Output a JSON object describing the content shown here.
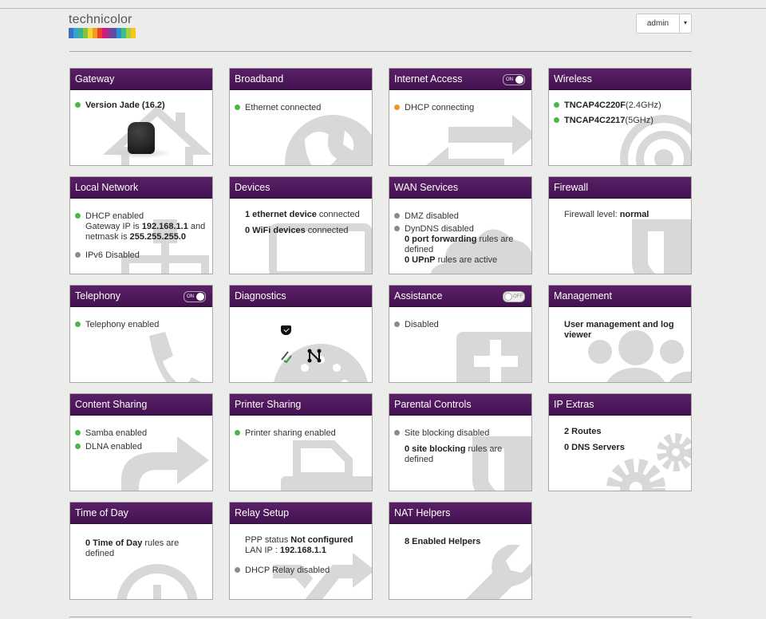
{
  "header": {
    "logo_text": "technicolor",
    "logo_colors": [
      "#3d6fc4",
      "#37a0d8",
      "#35b58f",
      "#82c341",
      "#f4d62b",
      "#f39a21",
      "#e8412c",
      "#d4187a",
      "#8b3a9b",
      "#5a4fa3",
      "#2c8fd1",
      "#3bbf8a",
      "#a6cf39",
      "#f6c51e"
    ],
    "user_menu": "admin",
    "user_caret": "▾"
  },
  "theme": {
    "header_purple": "#4a1656",
    "ok": "#4cb54c",
    "warn": "#e89a24",
    "off": "#8c8c8c"
  },
  "cards": {
    "gateway": {
      "title": "Gateway",
      "version": "Version Jade (16.2)",
      "icon": "house-icon"
    },
    "broadband": {
      "title": "Broadband",
      "status": "Ethernet connected",
      "icon": "globe-icon"
    },
    "internet": {
      "title": "Internet Access",
      "toggle": "ON",
      "status": "DHCP connecting",
      "icon": "arrows-icon"
    },
    "wireless": {
      "title": "Wireless",
      "ssid1": "TNCAP4C220F",
      "band1": "(2.4GHz)",
      "ssid2": "TNCAP4C2217",
      "band2": "(5GHz)",
      "icon": "wifi-target-icon"
    },
    "local": {
      "title": "Local Network",
      "dhcp": "DHCP enabled",
      "gw_pre": "Gateway IP is ",
      "gw_ip": "192.168.1.1",
      "gw_mid": " and netmask is ",
      "netmask": "255.255.255.0",
      "ipv6": "IPv6 Disabled",
      "icon": "network-icon"
    },
    "devices": {
      "title": "Devices",
      "eth_count": "1 ethernet device",
      "eth_suffix": " connected",
      "wifi_count": "0 WiFi devices",
      "wifi_suffix": " connected",
      "icon": "monitor-icon"
    },
    "wan": {
      "title": "WAN Services",
      "dmz": "DMZ disabled",
      "dyndns": "DynDNS disabled",
      "pf_count": "0 port forwarding",
      "pf_suffix": " rules are defined",
      "upnp_count": "0 UPnP",
      "upnp_suffix": " rules are active",
      "icon": "cloud-icon"
    },
    "firewall": {
      "title": "Firewall",
      "label": "Firewall level: ",
      "level": "normal",
      "icon": "shield-icon"
    },
    "telephony": {
      "title": "Telephony",
      "toggle": "ON",
      "status": "Telephony enabled",
      "icon": "phone-icon"
    },
    "diagnostics": {
      "title": "Diagnostics",
      "icon": "dial-icon"
    },
    "assistance": {
      "title": "Assistance",
      "toggle": "OFF",
      "status": "Disabled",
      "icon": "medkit-icon"
    },
    "management": {
      "title": "Management",
      "text": "User management and log viewer",
      "icon": "users-icon"
    },
    "content": {
      "title": "Content Sharing",
      "samba": "Samba enabled",
      "dlna": "DLNA enabled",
      "icon": "share-icon"
    },
    "printer": {
      "title": "Printer Sharing",
      "status": "Printer sharing enabled",
      "icon": "printer-icon"
    },
    "parental": {
      "title": "Parental Controls",
      "blocking": "Site blocking disabled",
      "rules_count": "0 site blocking",
      "rules_suffix": " rules are defined",
      "icon": "shield-icon"
    },
    "ipextras": {
      "title": "IP Extras",
      "routes": "2 Routes",
      "dns": "0 DNS Servers",
      "icon": "gears-icon"
    },
    "tod": {
      "title": "Time of Day",
      "count": "0 Time of Day",
      "suffix": " rules are defined",
      "icon": "clock-icon"
    },
    "relay": {
      "title": "Relay Setup",
      "ppp_label": "PPP status ",
      "ppp_value": "Not configured",
      "lan_label": "LAN IP : ",
      "lan_ip": "192.168.1.1",
      "relay": "DHCP Relay disabled",
      "icon": "shuffle-icon"
    },
    "nat": {
      "title": "NAT Helpers",
      "helpers": "8 Enabled Helpers",
      "icon": "wrench-icon"
    }
  }
}
